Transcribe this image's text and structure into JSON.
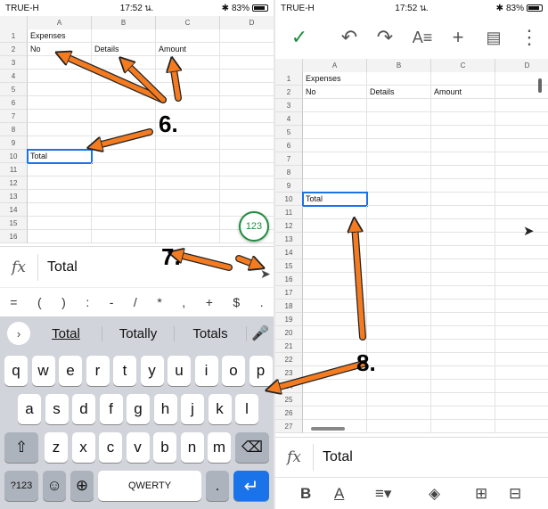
{
  "left": {
    "status": {
      "carrier": "TRUE-H",
      "time": "17:52 น.",
      "battery": "83%"
    },
    "columns": [
      "A",
      "B",
      "C",
      "D"
    ],
    "rows": [
      "1",
      "2",
      "3",
      "4",
      "5",
      "6",
      "7",
      "8",
      "9",
      "10",
      "11",
      "12",
      "13",
      "14",
      "15",
      "16"
    ],
    "cells": {
      "A1": "Expenses",
      "A2": "No",
      "B2": "Details",
      "C2": "Amount",
      "A10": "Total"
    },
    "fab_label": "123",
    "formula": {
      "fx": "fx",
      "value": "Total"
    },
    "symbols": [
      "=",
      "(",
      ")",
      ":",
      "-",
      "/",
      "*",
      ",",
      "+",
      "$",
      "."
    ],
    "suggestions": [
      "Total",
      "Totally",
      "Totals"
    ],
    "keys_row1": [
      "q",
      "w",
      "e",
      "r",
      "t",
      "y",
      "u",
      "i",
      "o",
      "p"
    ],
    "keys_row2": [
      "a",
      "s",
      "d",
      "f",
      "g",
      "h",
      "j",
      "k",
      "l"
    ],
    "keys_row3": [
      "z",
      "x",
      "c",
      "v",
      "b",
      "n",
      "m"
    ],
    "key_123": "?123",
    "key_space": "QWERTY",
    "key_dot": "."
  },
  "right": {
    "status": {
      "carrier": "TRUE-H",
      "time": "17:52 น.",
      "battery": "83%"
    },
    "columns": [
      "A",
      "B",
      "C",
      "D"
    ],
    "rows": [
      "1",
      "2",
      "3",
      "4",
      "5",
      "6",
      "7",
      "8",
      "9",
      "10",
      "11",
      "12",
      "13",
      "14",
      "15",
      "16",
      "17",
      "18",
      "19",
      "20",
      "21",
      "22",
      "23",
      "24",
      "25",
      "26",
      "27"
    ],
    "cells": {
      "A1": "Expenses",
      "A2": "No",
      "B2": "Details",
      "C2": "Amount",
      "A10": "Total"
    },
    "formula": {
      "fx": "fx",
      "value": "Total"
    }
  },
  "annotations": {
    "step6": "6.",
    "step7": "7.",
    "step8": "8."
  },
  "colors": {
    "accent": "#1a73e8",
    "arrow": "#f47b20",
    "green": "#1e8e3e"
  }
}
